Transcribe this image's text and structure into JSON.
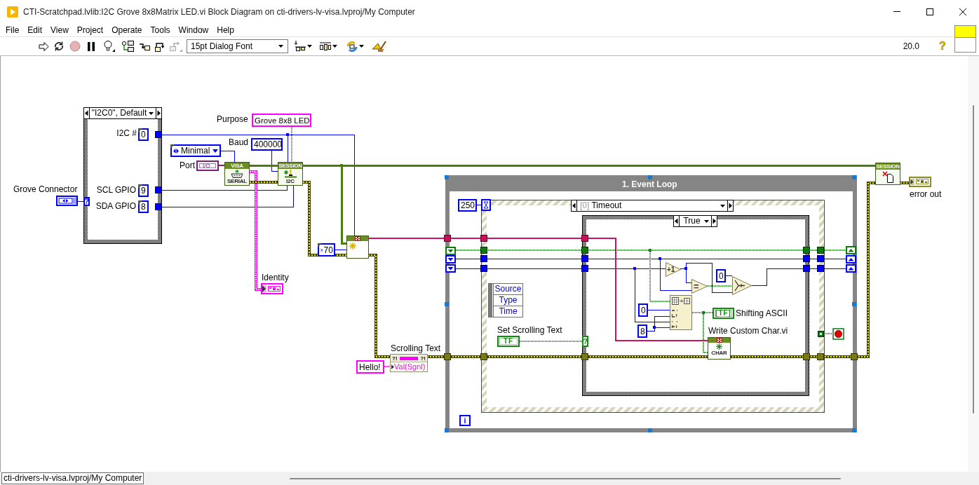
{
  "window": {
    "title": "CTI-Scratchpad.lvlib:I2C Grove 8x8Matrix LED.vi Block Diagram on cti-drivers-lv-visa.lvproj/My Computer"
  },
  "menu": [
    "File",
    "Edit",
    "View",
    "Project",
    "Operate",
    "Tools",
    "Window",
    "Help"
  ],
  "toolbar": {
    "buttons": [
      {
        "kind": "run",
        "disabled": false
      },
      {
        "kind": "run-continuously",
        "disabled": false
      },
      {
        "kind": "abort",
        "disabled": true
      },
      {
        "kind": "pause",
        "disabled": false
      },
      {
        "kind": "highlight",
        "disabled": false
      },
      {
        "kind": "retain",
        "disabled": false
      },
      {
        "kind": "step-into",
        "disabled": false
      },
      {
        "kind": "step-over",
        "disabled": false
      },
      {
        "kind": "step-out",
        "disabled": true
      }
    ],
    "font": "15pt Dialog Font",
    "tools": [
      {
        "kind": "align"
      },
      {
        "kind": "distribute"
      },
      {
        "kind": "reorder"
      },
      {
        "kind": "cleanup"
      }
    ],
    "number": "20.0",
    "help": "?"
  },
  "diagram": {
    "connector_case": {
      "selector": "\"I2C0\", Default",
      "terminal": "?",
      "constants": [
        {
          "label": "I2C #",
          "value": "0"
        },
        {
          "label": "SCL GPIO",
          "value": "9"
        },
        {
          "label": "SDA GPIO",
          "value": "8"
        }
      ]
    },
    "grove_connector": {
      "label": "Grove Connector"
    },
    "purpose": {
      "label": "Purpose",
      "value": "Grove 8x8 LED"
    },
    "flow_control": {
      "value": "Minimal"
    },
    "baud": {
      "label": "Baud",
      "value": "400000"
    },
    "port": {
      "label": "Port",
      "value": "I/O"
    },
    "visa_node": {
      "title": "VISA",
      "caption": "SERIAL"
    },
    "session_node": {
      "title": "SESSION",
      "caption": "I2C"
    },
    "identity": {
      "label": "Identity"
    },
    "count": {
      "radix": "x",
      "value": "70"
    },
    "scrolling_text": {
      "label": "Scrolling Text",
      "error_in": "?!",
      "error_out": "?!",
      "property": "Val(Sgnl)",
      "value": "Hello!"
    },
    "event_loop": {
      "title": "1. Event Loop",
      "iteration": "i",
      "timeout": "250",
      "event_case": {
        "index": "[0]",
        "name": "Timeout"
      },
      "event_data": [
        "Source",
        "Type",
        "Time"
      ],
      "control": {
        "label": "Set Scrolling Text",
        "value": "TF"
      },
      "case_terminal": "?",
      "inner_case": "True",
      "increment": "+1",
      "compare": "=",
      "constants": [
        "0",
        "0",
        "8"
      ],
      "indicator": {
        "value": "[TF]",
        "label": "Shifting ASCII"
      },
      "subvi": {
        "label": "Write Custom Char.vi",
        "caption": "CHAR"
      }
    },
    "session_close": {
      "title": "SESSION"
    },
    "error_out": {
      "label": "error out"
    }
  },
  "status_bar": {
    "path": "cti-drivers-lv-visa.lvproj/My Computer"
  }
}
